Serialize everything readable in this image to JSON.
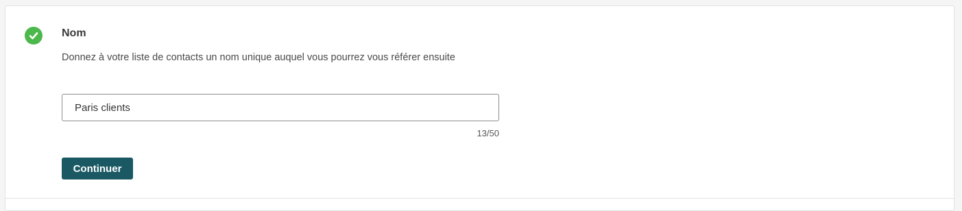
{
  "step": {
    "status_icon": "check-circle-icon",
    "title": "Nom",
    "description": "Donnez à votre liste de contacts un nom unique auquel vous pourrez vous référer ensuite"
  },
  "name_input": {
    "value": "Paris clients",
    "char_count": "13/50"
  },
  "actions": {
    "continue_label": "Continuer"
  },
  "colors": {
    "success": "#4cb84c",
    "primary_button": "#1a5963"
  }
}
